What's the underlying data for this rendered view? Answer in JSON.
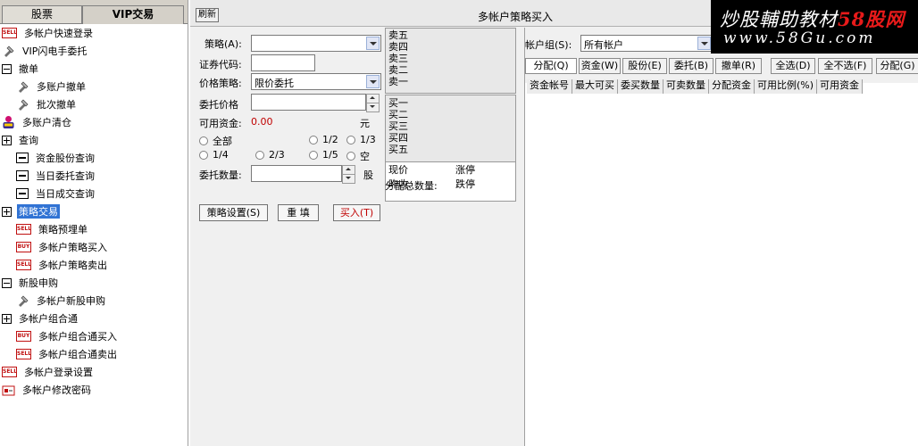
{
  "left_panel": {
    "tabs": [
      {
        "label": "股票",
        "active": false
      },
      {
        "label": "VIP交易",
        "active": true
      }
    ],
    "tree": [
      {
        "label": "多帐户快速登录",
        "icon": "sell-icon",
        "level": 0
      },
      {
        "label": "VIP闪电手委托",
        "icon": "wrench-icon",
        "level": 0
      },
      {
        "label": "撤单",
        "icon": "collapse-icon",
        "level": 0
      },
      {
        "label": "多账户撤单",
        "icon": "wrench-icon",
        "level": 1
      },
      {
        "label": "批次撤单",
        "icon": "wrench-icon",
        "level": 1
      },
      {
        "label": "多账户清仓",
        "icon": "person-icon",
        "level": 0
      },
      {
        "label": "查询",
        "icon": "expand-icon",
        "level": 0
      },
      {
        "label": "资金股份查询",
        "icon": "document-icon",
        "level": 1
      },
      {
        "label": "当日委托查询",
        "icon": "document-icon",
        "level": 1
      },
      {
        "label": "当日成交查询",
        "icon": "document-icon",
        "level": 1
      },
      {
        "label": "策略交易",
        "icon": "expand-icon",
        "level": 0,
        "selected": true
      },
      {
        "label": "策略预埋单",
        "icon": "sell-icon",
        "level": 1
      },
      {
        "label": "多帐户策略买入",
        "icon": "buy-icon",
        "level": 1
      },
      {
        "label": "多帐户策略卖出",
        "icon": "sell-icon",
        "level": 1
      },
      {
        "label": "新股申购",
        "icon": "collapse-icon",
        "level": 0
      },
      {
        "label": "多帐户新股申购",
        "icon": "wrench-icon",
        "level": 1
      },
      {
        "label": "多帐户组合通",
        "icon": "expand-icon",
        "level": 0
      },
      {
        "label": "多帐户组合通买入",
        "icon": "buy-icon",
        "level": 1
      },
      {
        "label": "多帐户组合通卖出",
        "icon": "sell-icon",
        "level": 1
      },
      {
        "label": "多帐户登录设置",
        "icon": "sell-icon",
        "level": 0
      },
      {
        "label": "多帐户修改密码",
        "icon": "password-icon",
        "level": 0
      }
    ],
    "icon_text": {
      "sell": "SELL",
      "buy": "BUY"
    }
  },
  "window": {
    "refresh_label": "刷新",
    "title": "多帐户策略买入"
  },
  "watermark": {
    "line1_prefix": "炒股輔助教材",
    "line1_brand": "58股网",
    "line2": "www.58Gu.com",
    "brand_color": "#e81a1a"
  },
  "form": {
    "strategy_label": "策略(A):",
    "strategy_value": "",
    "code_label": "证券代码:",
    "code_value": "",
    "price_strategy_label": "价格策略:",
    "price_strategy_value": "限价委托",
    "order_price_label": "委托价格",
    "order_price_value": "",
    "available_funds_label": "可用资金:",
    "available_funds_value": "0.00",
    "available_funds_unit": "元",
    "ratio_options": [
      "全部",
      "1/2",
      "1/3",
      "1/4",
      "2/3",
      "1/5",
      "空"
    ],
    "quantity_label": "委托数量:",
    "quantity_value": "",
    "quantity_unit": "股",
    "buttons": {
      "strategy_settings": "策略设置(S)",
      "reset": "重 填",
      "buy": "买入(T)"
    },
    "funds_value_color": "#c00000"
  },
  "quote": {
    "sell_levels": [
      "卖五",
      "卖四",
      "卖三",
      "卖二",
      "卖一"
    ],
    "buy_levels": [
      "买一",
      "买二",
      "买三",
      "买四",
      "买五"
    ],
    "current_price_label": "现价",
    "prev_close_label": "昨收",
    "limit_up_label": "涨停",
    "limit_down_label": "跌停",
    "alloc_total_label": "分配总数量:"
  },
  "account": {
    "group_label": "帐户组(S):",
    "group_value": "所有帐户",
    "tabs": [
      {
        "label": "分配(Q)",
        "active": true
      },
      {
        "label": "资金(W)",
        "active": false
      },
      {
        "label": "股份(E)",
        "active": false
      },
      {
        "label": "委托(B)",
        "active": false
      },
      {
        "label": "撤单(R)",
        "active": false
      },
      {
        "label": "全选(D)",
        "active": false
      },
      {
        "label": "全不选(F)",
        "active": false
      },
      {
        "label": "分配(G)",
        "active": false
      }
    ],
    "columns": [
      "资金帐号",
      "最大可买",
      "委买数量",
      "可卖数量",
      "分配资金",
      "可用比例(%)",
      "可用资金"
    ],
    "rows": []
  }
}
